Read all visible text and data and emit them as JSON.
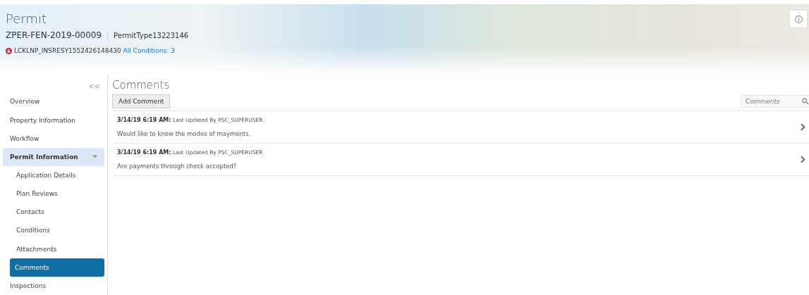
{
  "header": {
    "title": "Permit",
    "permit_number": "ZPER-FEN-2019-00009",
    "permit_type": "PermitType13223146",
    "lock_id": "LCKLNP_INSRESY1552426148430",
    "conditions_link": "All Conditions: 3"
  },
  "sidebar": {
    "collapse": "<<",
    "items": [
      {
        "label": "Overview",
        "selected": false,
        "kind": "item"
      },
      {
        "label": "Property Information",
        "selected": false,
        "kind": "item"
      },
      {
        "label": "Workflow",
        "selected": false,
        "kind": "item"
      },
      {
        "label": "Permit Information",
        "selected": false,
        "kind": "group",
        "expanded": true,
        "children": [
          {
            "label": "Application Details",
            "selected": false
          },
          {
            "label": "Plan Reviews",
            "selected": false
          },
          {
            "label": "Contacts",
            "selected": false
          },
          {
            "label": "Conditions",
            "selected": false
          },
          {
            "label": "Attachments",
            "selected": false
          },
          {
            "label": "Comments",
            "selected": true
          }
        ]
      },
      {
        "label": "Inspections",
        "selected": false,
        "kind": "item"
      }
    ]
  },
  "content": {
    "title": "Comments",
    "add_button": "Add Comment",
    "search": {
      "placeholder": "Comments"
    },
    "comments": [
      {
        "date": "3/14/19 6:19 AM:",
        "updated_by": "Last Updated By PSC_SUPERUSER",
        "text": "Would like to know the modes of mayments."
      },
      {
        "date": "3/14/19 6:19 AM:",
        "updated_by": "Last Updated By PSC_SUPERUSER",
        "text": "Are payments through check accepted?"
      }
    ]
  }
}
